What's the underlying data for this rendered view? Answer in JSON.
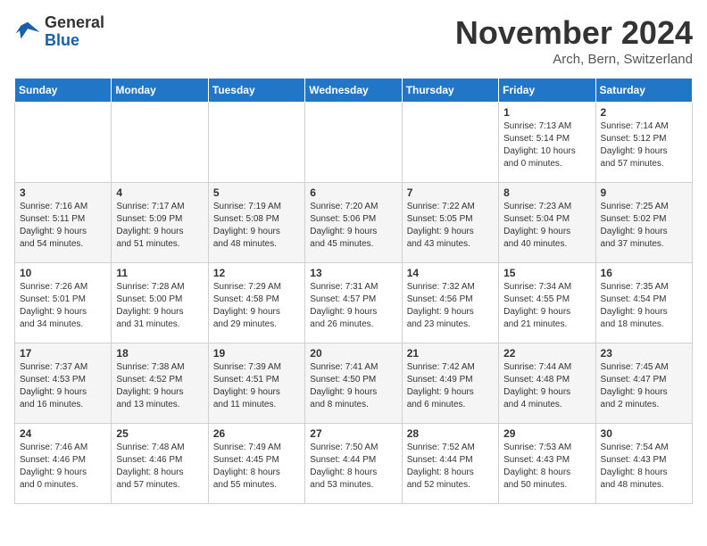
{
  "header": {
    "logo_line1": "General",
    "logo_line2": "Blue",
    "month_title": "November 2024",
    "location": "Arch, Bern, Switzerland"
  },
  "weekdays": [
    "Sunday",
    "Monday",
    "Tuesday",
    "Wednesday",
    "Thursday",
    "Friday",
    "Saturday"
  ],
  "weeks": [
    [
      {
        "day": "",
        "info": ""
      },
      {
        "day": "",
        "info": ""
      },
      {
        "day": "",
        "info": ""
      },
      {
        "day": "",
        "info": ""
      },
      {
        "day": "",
        "info": ""
      },
      {
        "day": "1",
        "info": "Sunrise: 7:13 AM\nSunset: 5:14 PM\nDaylight: 10 hours\nand 0 minutes."
      },
      {
        "day": "2",
        "info": "Sunrise: 7:14 AM\nSunset: 5:12 PM\nDaylight: 9 hours\nand 57 minutes."
      }
    ],
    [
      {
        "day": "3",
        "info": "Sunrise: 7:16 AM\nSunset: 5:11 PM\nDaylight: 9 hours\nand 54 minutes."
      },
      {
        "day": "4",
        "info": "Sunrise: 7:17 AM\nSunset: 5:09 PM\nDaylight: 9 hours\nand 51 minutes."
      },
      {
        "day": "5",
        "info": "Sunrise: 7:19 AM\nSunset: 5:08 PM\nDaylight: 9 hours\nand 48 minutes."
      },
      {
        "day": "6",
        "info": "Sunrise: 7:20 AM\nSunset: 5:06 PM\nDaylight: 9 hours\nand 45 minutes."
      },
      {
        "day": "7",
        "info": "Sunrise: 7:22 AM\nSunset: 5:05 PM\nDaylight: 9 hours\nand 43 minutes."
      },
      {
        "day": "8",
        "info": "Sunrise: 7:23 AM\nSunset: 5:04 PM\nDaylight: 9 hours\nand 40 minutes."
      },
      {
        "day": "9",
        "info": "Sunrise: 7:25 AM\nSunset: 5:02 PM\nDaylight: 9 hours\nand 37 minutes."
      }
    ],
    [
      {
        "day": "10",
        "info": "Sunrise: 7:26 AM\nSunset: 5:01 PM\nDaylight: 9 hours\nand 34 minutes."
      },
      {
        "day": "11",
        "info": "Sunrise: 7:28 AM\nSunset: 5:00 PM\nDaylight: 9 hours\nand 31 minutes."
      },
      {
        "day": "12",
        "info": "Sunrise: 7:29 AM\nSunset: 4:58 PM\nDaylight: 9 hours\nand 29 minutes."
      },
      {
        "day": "13",
        "info": "Sunrise: 7:31 AM\nSunset: 4:57 PM\nDaylight: 9 hours\nand 26 minutes."
      },
      {
        "day": "14",
        "info": "Sunrise: 7:32 AM\nSunset: 4:56 PM\nDaylight: 9 hours\nand 23 minutes."
      },
      {
        "day": "15",
        "info": "Sunrise: 7:34 AM\nSunset: 4:55 PM\nDaylight: 9 hours\nand 21 minutes."
      },
      {
        "day": "16",
        "info": "Sunrise: 7:35 AM\nSunset: 4:54 PM\nDaylight: 9 hours\nand 18 minutes."
      }
    ],
    [
      {
        "day": "17",
        "info": "Sunrise: 7:37 AM\nSunset: 4:53 PM\nDaylight: 9 hours\nand 16 minutes."
      },
      {
        "day": "18",
        "info": "Sunrise: 7:38 AM\nSunset: 4:52 PM\nDaylight: 9 hours\nand 13 minutes."
      },
      {
        "day": "19",
        "info": "Sunrise: 7:39 AM\nSunset: 4:51 PM\nDaylight: 9 hours\nand 11 minutes."
      },
      {
        "day": "20",
        "info": "Sunrise: 7:41 AM\nSunset: 4:50 PM\nDaylight: 9 hours\nand 8 minutes."
      },
      {
        "day": "21",
        "info": "Sunrise: 7:42 AM\nSunset: 4:49 PM\nDaylight: 9 hours\nand 6 minutes."
      },
      {
        "day": "22",
        "info": "Sunrise: 7:44 AM\nSunset: 4:48 PM\nDaylight: 9 hours\nand 4 minutes."
      },
      {
        "day": "23",
        "info": "Sunrise: 7:45 AM\nSunset: 4:47 PM\nDaylight: 9 hours\nand 2 minutes."
      }
    ],
    [
      {
        "day": "24",
        "info": "Sunrise: 7:46 AM\nSunset: 4:46 PM\nDaylight: 9 hours\nand 0 minutes."
      },
      {
        "day": "25",
        "info": "Sunrise: 7:48 AM\nSunset: 4:46 PM\nDaylight: 8 hours\nand 57 minutes."
      },
      {
        "day": "26",
        "info": "Sunrise: 7:49 AM\nSunset: 4:45 PM\nDaylight: 8 hours\nand 55 minutes."
      },
      {
        "day": "27",
        "info": "Sunrise: 7:50 AM\nSunset: 4:44 PM\nDaylight: 8 hours\nand 53 minutes."
      },
      {
        "day": "28",
        "info": "Sunrise: 7:52 AM\nSunset: 4:44 PM\nDaylight: 8 hours\nand 52 minutes."
      },
      {
        "day": "29",
        "info": "Sunrise: 7:53 AM\nSunset: 4:43 PM\nDaylight: 8 hours\nand 50 minutes."
      },
      {
        "day": "30",
        "info": "Sunrise: 7:54 AM\nSunset: 4:43 PM\nDaylight: 8 hours\nand 48 minutes."
      }
    ]
  ]
}
